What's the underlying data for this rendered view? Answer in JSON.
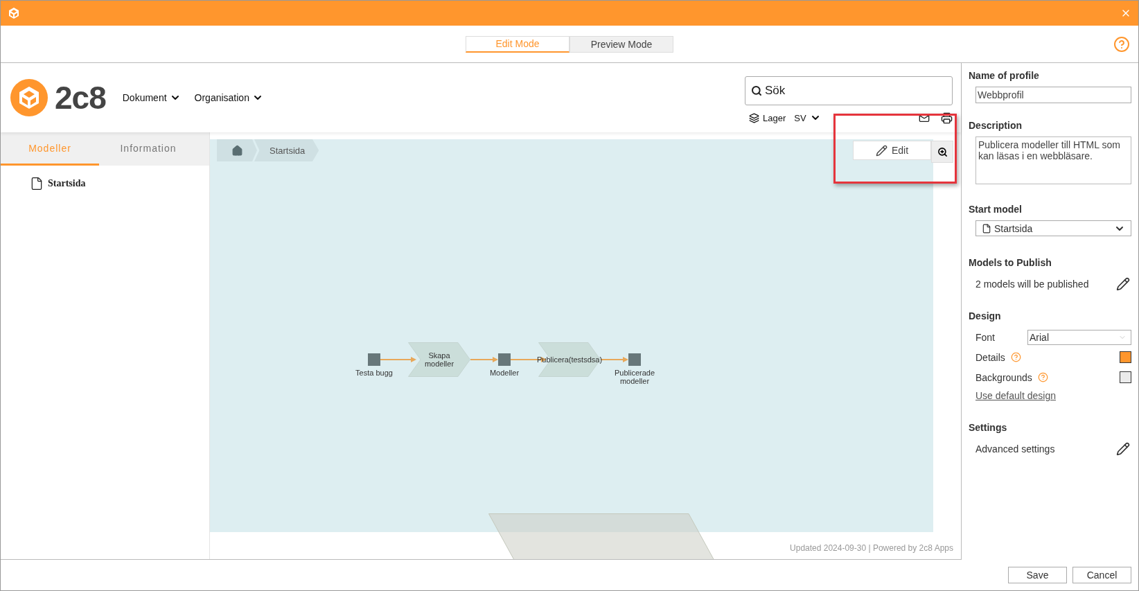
{
  "modes": [
    {
      "label": "Edit Mode",
      "selected": true
    },
    {
      "label": "Preview Mode",
      "selected": false
    }
  ],
  "header": {
    "logo_text": "2c8",
    "menus": [
      {
        "label": "Dokument"
      },
      {
        "label": "Organisation"
      }
    ],
    "search": {
      "placeholder": "Sök"
    },
    "layers": "Lager",
    "language": "SV"
  },
  "sidebar": {
    "tabs": [
      {
        "label": "Modeller",
        "selected": true
      },
      {
        "label": "Information",
        "selected": false
      }
    ],
    "items": [
      {
        "label": "Startsida"
      }
    ]
  },
  "breadcrumb": [
    {
      "label": "Startsida"
    }
  ],
  "edit_button": "Edit",
  "diagram": {
    "nodes": [
      {
        "kind": "event",
        "label": "Testa bugg"
      },
      {
        "kind": "process",
        "label": "Skapa modeller"
      },
      {
        "kind": "event",
        "label": "Modeller"
      },
      {
        "kind": "process",
        "label": "Publicera(testsdsa)"
      },
      {
        "kind": "event",
        "label": "Publicerade modeller"
      }
    ]
  },
  "footer": "Updated 2024-09-30 | Powered by 2c8 Apps",
  "profile": {
    "name": {
      "label": "Name of profile",
      "value": "Webbprofil"
    },
    "description": {
      "label": "Description",
      "value": "Publicera modeller till HTML som kan läsas i en webbläsare."
    },
    "start_model": {
      "label": "Start model",
      "value": "Startsida"
    },
    "models": {
      "label": "Models to Publish",
      "text": "2 models will be published"
    },
    "design": {
      "label": "Design",
      "font_label": "Font",
      "font": "Arial",
      "colors": [
        {
          "label": "Details",
          "color": "#ff962d"
        },
        {
          "label": "Backgrounds",
          "color": "#ebebeb"
        }
      ],
      "reset_link": "Use default design"
    },
    "settings": {
      "label": "Settings",
      "advanced": "Advanced settings"
    }
  },
  "buttons": [
    {
      "label": "Save"
    },
    {
      "label": "Cancel"
    }
  ]
}
